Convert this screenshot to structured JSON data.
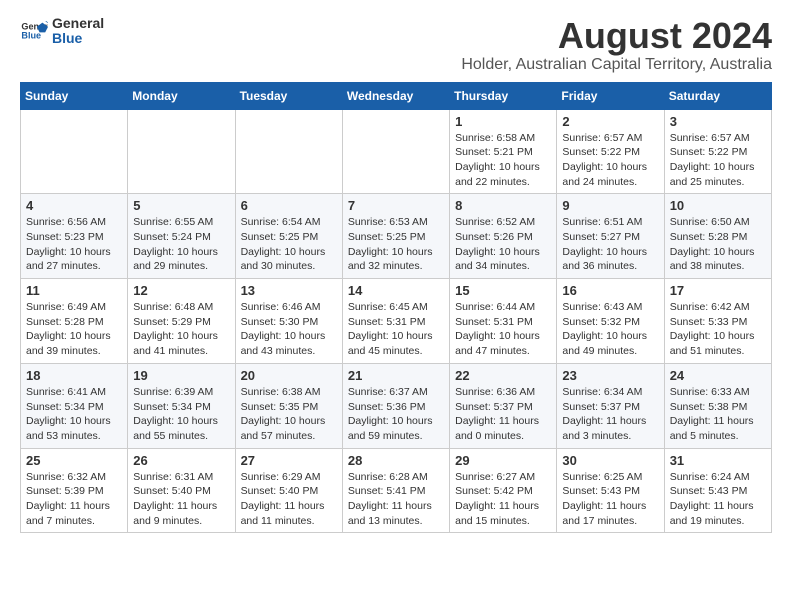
{
  "header": {
    "logo_line1": "General",
    "logo_line2": "Blue",
    "main_title": "August 2024",
    "subtitle": "Holder, Australian Capital Territory, Australia"
  },
  "calendar": {
    "weekdays": [
      "Sunday",
      "Monday",
      "Tuesday",
      "Wednesday",
      "Thursday",
      "Friday",
      "Saturday"
    ],
    "weeks": [
      [
        {
          "day": "",
          "info": ""
        },
        {
          "day": "",
          "info": ""
        },
        {
          "day": "",
          "info": ""
        },
        {
          "day": "",
          "info": ""
        },
        {
          "day": "1",
          "info": "Sunrise: 6:58 AM\nSunset: 5:21 PM\nDaylight: 10 hours\nand 22 minutes."
        },
        {
          "day": "2",
          "info": "Sunrise: 6:57 AM\nSunset: 5:22 PM\nDaylight: 10 hours\nand 24 minutes."
        },
        {
          "day": "3",
          "info": "Sunrise: 6:57 AM\nSunset: 5:22 PM\nDaylight: 10 hours\nand 25 minutes."
        }
      ],
      [
        {
          "day": "4",
          "info": "Sunrise: 6:56 AM\nSunset: 5:23 PM\nDaylight: 10 hours\nand 27 minutes."
        },
        {
          "day": "5",
          "info": "Sunrise: 6:55 AM\nSunset: 5:24 PM\nDaylight: 10 hours\nand 29 minutes."
        },
        {
          "day": "6",
          "info": "Sunrise: 6:54 AM\nSunset: 5:25 PM\nDaylight: 10 hours\nand 30 minutes."
        },
        {
          "day": "7",
          "info": "Sunrise: 6:53 AM\nSunset: 5:25 PM\nDaylight: 10 hours\nand 32 minutes."
        },
        {
          "day": "8",
          "info": "Sunrise: 6:52 AM\nSunset: 5:26 PM\nDaylight: 10 hours\nand 34 minutes."
        },
        {
          "day": "9",
          "info": "Sunrise: 6:51 AM\nSunset: 5:27 PM\nDaylight: 10 hours\nand 36 minutes."
        },
        {
          "day": "10",
          "info": "Sunrise: 6:50 AM\nSunset: 5:28 PM\nDaylight: 10 hours\nand 38 minutes."
        }
      ],
      [
        {
          "day": "11",
          "info": "Sunrise: 6:49 AM\nSunset: 5:28 PM\nDaylight: 10 hours\nand 39 minutes."
        },
        {
          "day": "12",
          "info": "Sunrise: 6:48 AM\nSunset: 5:29 PM\nDaylight: 10 hours\nand 41 minutes."
        },
        {
          "day": "13",
          "info": "Sunrise: 6:46 AM\nSunset: 5:30 PM\nDaylight: 10 hours\nand 43 minutes."
        },
        {
          "day": "14",
          "info": "Sunrise: 6:45 AM\nSunset: 5:31 PM\nDaylight: 10 hours\nand 45 minutes."
        },
        {
          "day": "15",
          "info": "Sunrise: 6:44 AM\nSunset: 5:31 PM\nDaylight: 10 hours\nand 47 minutes."
        },
        {
          "day": "16",
          "info": "Sunrise: 6:43 AM\nSunset: 5:32 PM\nDaylight: 10 hours\nand 49 minutes."
        },
        {
          "day": "17",
          "info": "Sunrise: 6:42 AM\nSunset: 5:33 PM\nDaylight: 10 hours\nand 51 minutes."
        }
      ],
      [
        {
          "day": "18",
          "info": "Sunrise: 6:41 AM\nSunset: 5:34 PM\nDaylight: 10 hours\nand 53 minutes."
        },
        {
          "day": "19",
          "info": "Sunrise: 6:39 AM\nSunset: 5:34 PM\nDaylight: 10 hours\nand 55 minutes."
        },
        {
          "day": "20",
          "info": "Sunrise: 6:38 AM\nSunset: 5:35 PM\nDaylight: 10 hours\nand 57 minutes."
        },
        {
          "day": "21",
          "info": "Sunrise: 6:37 AM\nSunset: 5:36 PM\nDaylight: 10 hours\nand 59 minutes."
        },
        {
          "day": "22",
          "info": "Sunrise: 6:36 AM\nSunset: 5:37 PM\nDaylight: 11 hours\nand 0 minutes."
        },
        {
          "day": "23",
          "info": "Sunrise: 6:34 AM\nSunset: 5:37 PM\nDaylight: 11 hours\nand 3 minutes."
        },
        {
          "day": "24",
          "info": "Sunrise: 6:33 AM\nSunset: 5:38 PM\nDaylight: 11 hours\nand 5 minutes."
        }
      ],
      [
        {
          "day": "25",
          "info": "Sunrise: 6:32 AM\nSunset: 5:39 PM\nDaylight: 11 hours\nand 7 minutes."
        },
        {
          "day": "26",
          "info": "Sunrise: 6:31 AM\nSunset: 5:40 PM\nDaylight: 11 hours\nand 9 minutes."
        },
        {
          "day": "27",
          "info": "Sunrise: 6:29 AM\nSunset: 5:40 PM\nDaylight: 11 hours\nand 11 minutes."
        },
        {
          "day": "28",
          "info": "Sunrise: 6:28 AM\nSunset: 5:41 PM\nDaylight: 11 hours\nand 13 minutes."
        },
        {
          "day": "29",
          "info": "Sunrise: 6:27 AM\nSunset: 5:42 PM\nDaylight: 11 hours\nand 15 minutes."
        },
        {
          "day": "30",
          "info": "Sunrise: 6:25 AM\nSunset: 5:43 PM\nDaylight: 11 hours\nand 17 minutes."
        },
        {
          "day": "31",
          "info": "Sunrise: 6:24 AM\nSunset: 5:43 PM\nDaylight: 11 hours\nand 19 minutes."
        }
      ]
    ]
  }
}
